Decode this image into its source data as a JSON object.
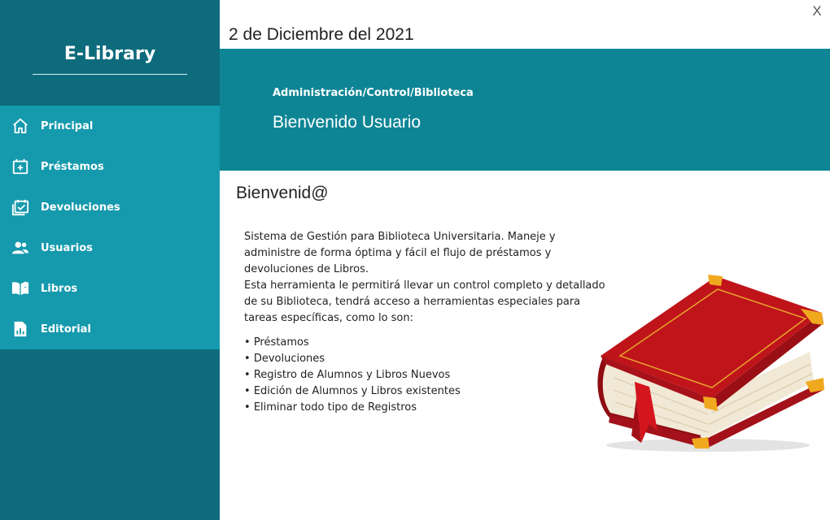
{
  "sidebar": {
    "brand": "E-Library",
    "items": [
      {
        "label": "Principal",
        "icon": "home-icon"
      },
      {
        "label": "Préstamos",
        "icon": "calendar-add-icon"
      },
      {
        "label": "Devoluciones",
        "icon": "calendar-check-icon"
      },
      {
        "label": "Usuarios",
        "icon": "users-icon"
      },
      {
        "label": "Libros",
        "icon": "book-open-icon"
      },
      {
        "label": "Editorial",
        "icon": "report-icon"
      }
    ]
  },
  "window": {
    "close_label": "X"
  },
  "header": {
    "date": "2 de Diciembre del 2021",
    "breadcrumb": "Administración/Control/Biblioteca",
    "welcome": "Bienvenido Usuario"
  },
  "content": {
    "title": "Bienvenid@",
    "paragraph1": "Sistema de Gestión para Biblioteca Universitaria. Maneje y administre de forma óptima y fácil el flujo de préstamos y devoluciones de Libros.",
    "paragraph2": "Esta herramienta le permitirá llevar un control completo y detallado de su Biblioteca, tendrá acceso a herramientas especiales para tareas específicas, como lo son:",
    "features": [
      "Préstamos",
      "Devoluciones",
      "Registro de Alumnos y Libros Nuevos",
      "Edición de Alumnos y Libros existentes",
      "Eliminar todo tipo de Registros"
    ]
  },
  "colors": {
    "sidebar_dark": "#0d6b7c",
    "sidebar_menu": "#1599ad",
    "banner": "#0e8595",
    "book_red": "#c0141b"
  }
}
